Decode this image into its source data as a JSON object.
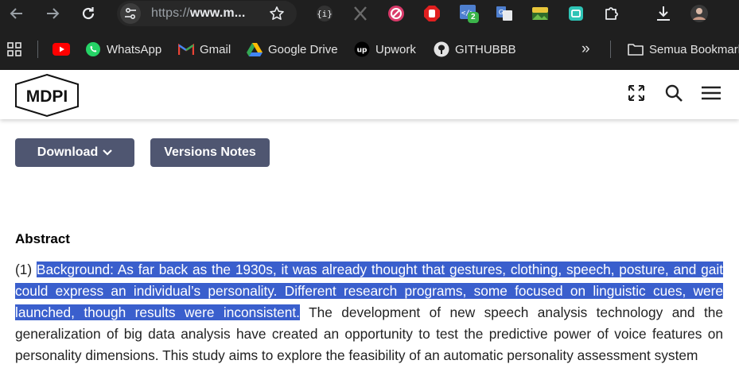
{
  "browser": {
    "url_prefix": "https://",
    "url_host": "www.m...",
    "extension_badge": "2",
    "bookmarks": [
      {
        "label": "WhatsApp"
      },
      {
        "label": "Gmail"
      },
      {
        "label": "Google Drive"
      },
      {
        "label": "Upwork"
      },
      {
        "label": "GITHUBBB"
      }
    ],
    "more_bookmarks": "»",
    "all_bookmarks_label": "Semua Bookmark"
  },
  "site": {
    "logo_text": "MDPI"
  },
  "actions": {
    "download_label": "Download",
    "versions_label": "Versions Notes"
  },
  "abstract": {
    "heading": "Abstract",
    "number": "(1)",
    "highlighted": "Background: As far back as the 1930s, it was already thought that gestures, clothing, speech, posture, and gait could express an individual’s personality. Different research programs, some focused on linguistic cues, were launched, though results were inconsistent.",
    "rest": " The development of new speech analysis technology and the generalization of big data analysis have created an opportunity to test the predictive power of voice features on personality dimensions. This study aims to explore the feasibility of an automatic personality assessment system"
  },
  "colors": {
    "chrome_bg": "#1f1f1f",
    "button_bg": "#4f5671",
    "selection": "#3a5fcd"
  }
}
